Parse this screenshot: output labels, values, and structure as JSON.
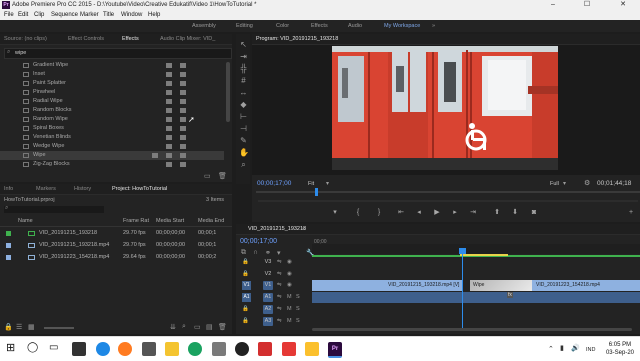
{
  "window": {
    "title": "Adobe Premiere Pro CC 2015 - D:\\Youtube\\Video\\Creative Edukatif\\Video 1\\HowToTutorial *",
    "app_icon": "Pr"
  },
  "menu": [
    "File",
    "Edit",
    "Clip",
    "Sequence",
    "Marker",
    "Title",
    "Window",
    "Help"
  ],
  "workspaces": [
    "Assembly",
    "Editing",
    "Color",
    "Effects",
    "Audio",
    "My Workspace",
    "»"
  ],
  "source_panel": {
    "tabs": [
      "Source: (no clips)",
      "Effect Controls",
      "Effects",
      "Audio Clip Mixer: VID_"
    ],
    "search_value": "wipe",
    "effects": [
      "Gradient Wipe",
      "Inset",
      "Paint Splatter",
      "Pinwheel",
      "Radial Wipe",
      "Random Blocks",
      "Random Wipe",
      "Spiral Boxes",
      "Venetian Blinds",
      "Wedge Wipe",
      "Wipe",
      "Zig-Zag Blocks"
    ],
    "selected_effect": "Wipe"
  },
  "project_panel": {
    "tabs": [
      "Info",
      "Markers",
      "History",
      "Project: HowToTutorial"
    ],
    "project_file": "HowToTutorial.prproj",
    "item_count": "3 Items",
    "columns": [
      "Name",
      "Frame Rat",
      "Media Start",
      "Media End"
    ],
    "items": [
      {
        "name": "VID_20191215_193218",
        "fps": "29.70 fps",
        "start": "00;00;00;00",
        "end": "00;00;1",
        "color": "#3fb24e"
      },
      {
        "name": "VID_20191215_193218.mp4",
        "fps": "29.70 fps",
        "start": "00;00;00;00",
        "end": "00;00;1",
        "color": "#8db0e0"
      },
      {
        "name": "VID_20191223_154218.mp4",
        "fps": "29.64 fps",
        "start": "00;00;00;00",
        "end": "00;00;2",
        "color": "#8db0e0"
      }
    ]
  },
  "program_monitor": {
    "title": "Program: VID_20191215_193218",
    "timecode": "00;00;17;00",
    "fit": "Fit",
    "quality": "Full",
    "duration": "00;01;44;18"
  },
  "timeline": {
    "tab": "VID_20191215_193218",
    "timecode": "00;00;17;00",
    "ruler_label": "00;00",
    "tracks": [
      "V3",
      "V2",
      "V1",
      "A1",
      "A2",
      "A3"
    ],
    "clips": [
      {
        "name": "VID_20191215_193218.mp4 [V]"
      },
      {
        "name": "VID_20191223_154218.mp4"
      }
    ],
    "transition": "Wipe",
    "fx_badge": "fx"
  },
  "taskbar": {
    "time": "6:05 PM",
    "date": "03-Sep-20",
    "lang": "IND"
  },
  "colors": {
    "accent": "#7ea6e6",
    "train_red": "#d94432",
    "clip_blue": "#8eb1e0",
    "playhead": "#2d8ceb"
  }
}
